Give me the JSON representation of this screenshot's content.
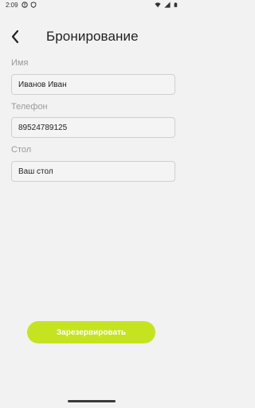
{
  "status_bar": {
    "time": "2:09",
    "left_icons": [
      "alert-circle-icon",
      "shield-icon"
    ],
    "right_icons": [
      "wifi-icon",
      "signal-icon",
      "battery-icon"
    ]
  },
  "header": {
    "title": "Бронирование",
    "back_icon": "back-arrow-icon"
  },
  "form": {
    "name": {
      "label": "Имя",
      "value": "Иванов Иван"
    },
    "phone": {
      "label": "Телефон",
      "value": "89524789125"
    },
    "table": {
      "label": "Стол",
      "value": "Ваш стол"
    }
  },
  "actions": {
    "reserve_label": "Зарезервировать"
  },
  "colors": {
    "accent": "#c5e41f",
    "background": "#f2f2f2",
    "label": "#9a9a9a"
  }
}
